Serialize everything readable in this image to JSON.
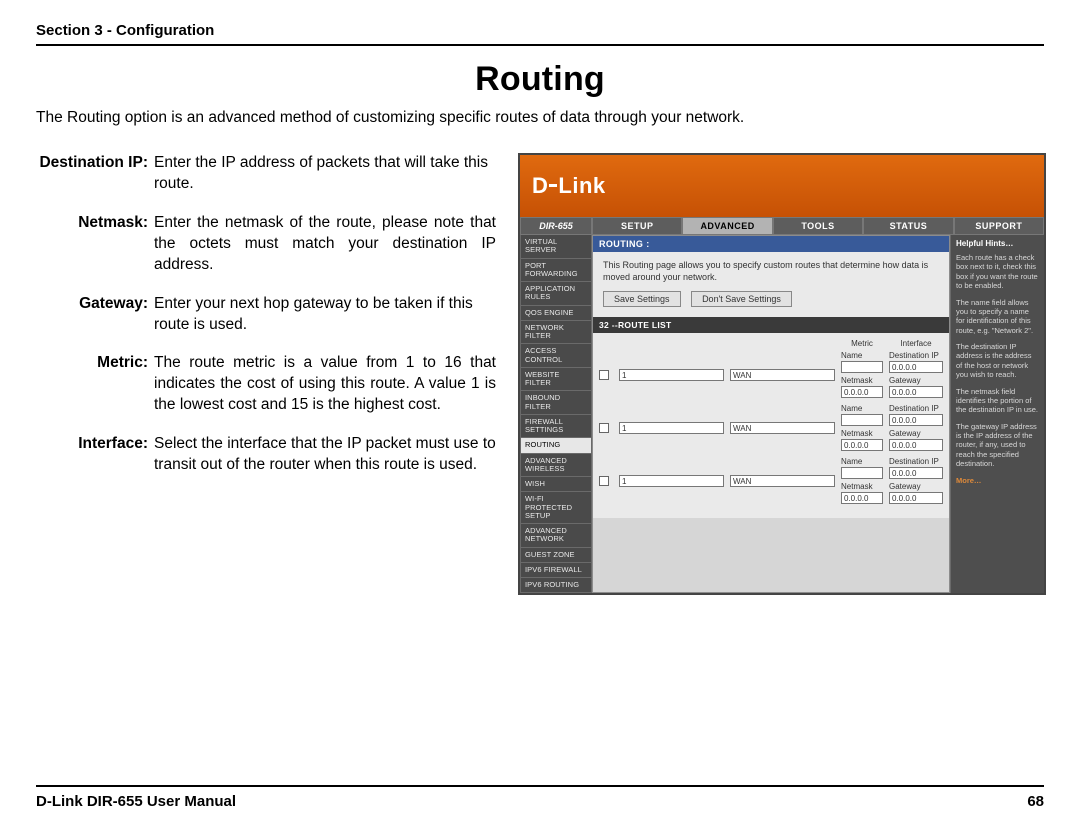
{
  "section_header": "Section 3 - Configuration",
  "page_title": "Routing",
  "intro": "The Routing option is an advanced method of customizing specific routes of data through your network.",
  "defs": [
    {
      "label": "Destination IP:",
      "body": "Enter the IP address of packets that will take this route.",
      "justify": false
    },
    {
      "label": "Netmask:",
      "body": "Enter the netmask of the route, please note that the octets must match your destination IP address.",
      "justify": true
    },
    {
      "label": "Gateway:",
      "body": "Enter your next hop gateway to be taken if this route is used.",
      "justify": false
    },
    {
      "label": "Metric:",
      "body": "The route metric is a value from 1 to 16 that indicates the cost of using this route. A value 1 is the lowest cost and 15 is the highest cost.",
      "justify": true
    },
    {
      "label": "Interface:",
      "body": "Select the interface that the IP packet must use to transit out of the router when this route is used.",
      "justify": false
    }
  ],
  "shot": {
    "brand": "D-Link",
    "model": "DIR-655",
    "tabs": [
      "SETUP",
      "ADVANCED",
      "TOOLS",
      "STATUS",
      "SUPPORT"
    ],
    "active_tab": 1,
    "sidebar": [
      "VIRTUAL SERVER",
      "PORT FORWARDING",
      "APPLICATION RULES",
      "QOS ENGINE",
      "NETWORK FILTER",
      "ACCESS CONTROL",
      "WEBSITE FILTER",
      "INBOUND FILTER",
      "FIREWALL SETTINGS",
      "ROUTING",
      "ADVANCED WIRELESS",
      "WISH",
      "WI-FI PROTECTED SETUP",
      "ADVANCED NETWORK",
      "GUEST ZONE",
      "IPV6 FIREWALL",
      "IPV6 ROUTING"
    ],
    "sidebar_selected": 9,
    "panel_title": "ROUTING :",
    "panel_desc": "This Routing page allows you to specify custom routes that determine how data is moved around your network.",
    "save_btn": "Save Settings",
    "dont_save_btn": "Don't Save Settings",
    "routelist_title": "32 --ROUTE LIST",
    "col": {
      "metric": "Metric",
      "interface": "Interface"
    },
    "labels": {
      "name": "Name",
      "dest": "Destination IP",
      "netmask": "Netmask",
      "gateway": "Gateway"
    },
    "routes": [
      {
        "name": "",
        "dest": "0.0.0.0",
        "netmask": "0.0.0.0",
        "gateway": "0.0.0.0",
        "metric": "1",
        "iface": "WAN"
      },
      {
        "name": "",
        "dest": "0.0.0.0",
        "netmask": "0.0.0.0",
        "gateway": "0.0.0.0",
        "metric": "1",
        "iface": "WAN"
      },
      {
        "name": "",
        "dest": "0.0.0.0",
        "netmask": "0.0.0.0",
        "gateway": "0.0.0.0",
        "metric": "1",
        "iface": "WAN"
      }
    ],
    "hints": {
      "title": "Helpful Hints…",
      "p1": "Each route has a check box next to it, check this box if you want the route to be enabled.",
      "p2": "The name field allows you to specify a name for identification of this route, e.g. \"Network 2\".",
      "p3": "The destination IP address is the address of the host or network you wish to reach.",
      "p4": "The netmask field identifies the portion of the destination IP in use.",
      "p5": "The gateway IP address is the IP address of the router, if any, used to reach the specified destination.",
      "more": "More…"
    }
  },
  "footer": {
    "left": "D-Link DIR-655 User Manual",
    "right": "68"
  }
}
